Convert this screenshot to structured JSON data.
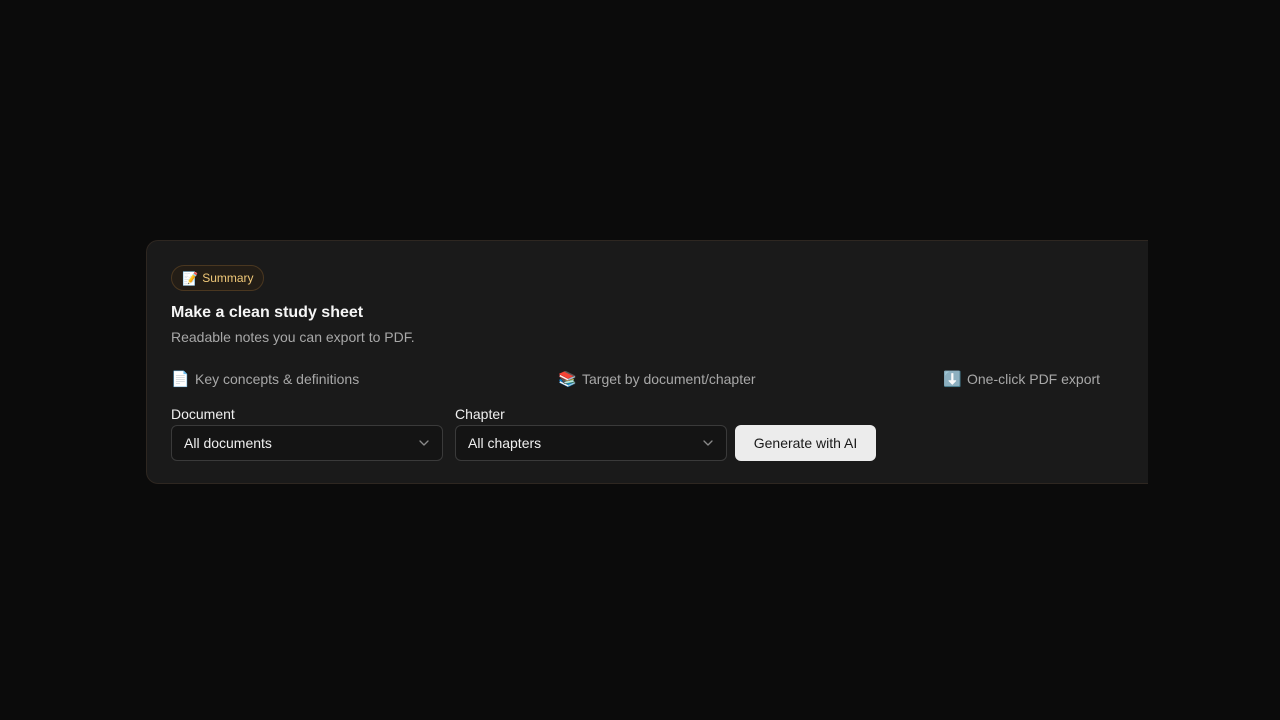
{
  "card": {
    "badge": {
      "icon": "📝",
      "icon_name": "memo-icon",
      "label": "Summary"
    },
    "title": "Make a clean study sheet",
    "subtitle": "Readable notes you can export to PDF.",
    "features": [
      {
        "icon": "📄",
        "icon_name": "document-icon",
        "label": "Key concepts & definitions"
      },
      {
        "icon": "📚",
        "icon_name": "books-icon",
        "label": "Target by document/chapter"
      },
      {
        "icon": "⬇️",
        "icon_name": "download-arrow-icon",
        "label": "One-click PDF export"
      }
    ],
    "document": {
      "label": "Document",
      "selected": "All documents"
    },
    "chapter": {
      "label": "Chapter",
      "selected": "All chapters"
    },
    "generate_label": "Generate with AI"
  },
  "colors": {
    "background": "#0b0b0b",
    "card": "#1a1a1a",
    "badge_text": "#f0c878",
    "button": "#ececec"
  }
}
